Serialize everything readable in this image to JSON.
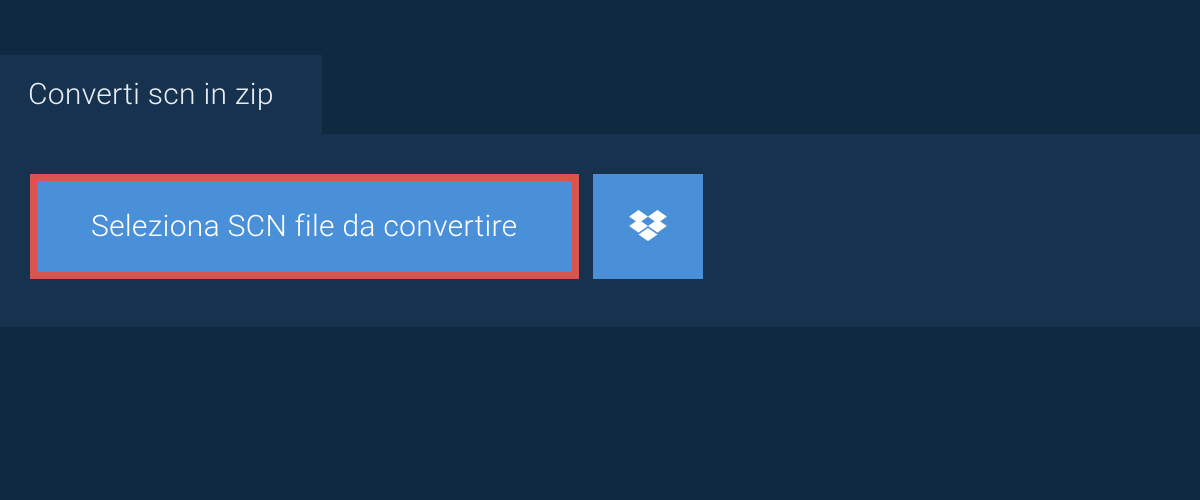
{
  "tab": {
    "label": "Converti scn in zip"
  },
  "buttons": {
    "select_file_label": "Seleziona SCN file da convertire"
  }
}
